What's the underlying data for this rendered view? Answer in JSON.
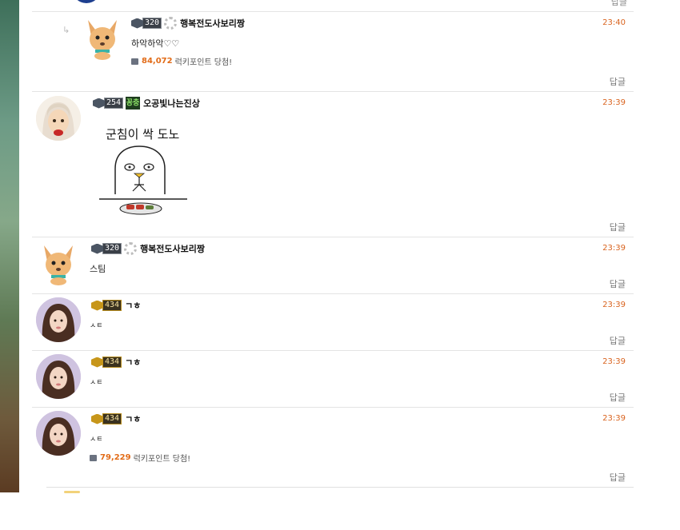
{
  "top_fragment": {
    "reply_label": "답글"
  },
  "comments": [
    {
      "level": "320",
      "nickname": "행복전도사보리짱",
      "time": "23:40",
      "text": "하악하악♡♡",
      "point_amount": "84,072",
      "point_text": "럭키포인트 당첨!",
      "reply_label": "답글",
      "is_reply": true
    },
    {
      "level": "254",
      "nickname": "오공빛나는진상",
      "time": "23:39",
      "badge": "꽁충",
      "sticker_text": "군침이 싹 도노",
      "reply_label": "답글"
    },
    {
      "level": "320",
      "nickname": "행복전도사보리짱",
      "time": "23:39",
      "text": "스팀",
      "reply_label": "답글"
    },
    {
      "level": "434",
      "nickname": "ㄱㅎ",
      "time": "23:39",
      "text": "ㅅㅌ",
      "reply_label": "답글"
    },
    {
      "level": "434",
      "nickname": "ㄱㅎ",
      "time": "23:39",
      "text": "ㅅㅌ",
      "reply_label": "답글"
    },
    {
      "level": "434",
      "nickname": "ㄱㅎ",
      "time": "23:39",
      "text": "ㅅㅌ",
      "point_amount": "79,229",
      "point_text": "럭키포인트 당첨!",
      "reply_label": "답글"
    }
  ],
  "colors": {
    "time": "#d9631e",
    "point": "#e26b17"
  }
}
